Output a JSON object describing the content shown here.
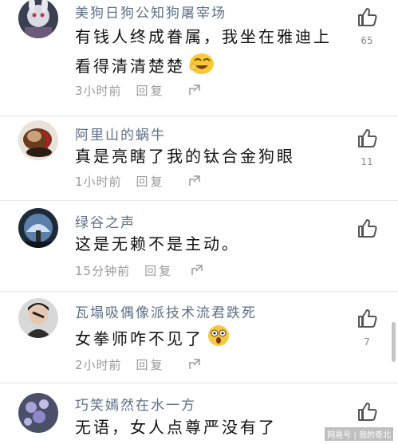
{
  "comments": [
    {
      "username": "美狗日狗公知狗屠宰场",
      "text": "有钱人终成眷属，我坐在雅迪上看得清清楚楚",
      "emoji": "laughing-face-emoji",
      "time": "3小时前",
      "reply": "回复",
      "likes": "65"
    },
    {
      "username": "阿里山的蜗牛",
      "text": "真是亮瞎了我的钛合金狗眼",
      "emoji": "",
      "time": "1小时前",
      "reply": "回复",
      "likes": "11"
    },
    {
      "username": "绿谷之声",
      "text": "这是无赖不是主动。",
      "emoji": "",
      "time": "15分钟前",
      "reply": "回复",
      "likes": ""
    },
    {
      "username": "瓦塌吸偶像派技术流君跌死",
      "text": "女拳师咋不见了",
      "emoji": "shocked-face-emoji",
      "time": "2小时前",
      "reply": "回复",
      "likes": "7"
    },
    {
      "username": "巧笑嫣然在水一方",
      "text": "无语，女人点尊严没有了",
      "emoji": "",
      "time": "",
      "reply": "",
      "likes": ""
    }
  ],
  "watermark": "网易号 | 我的奇北",
  "colors": {
    "username": "#5c6f86",
    "meta": "#9a9a9a",
    "divider": "#e6e6e6",
    "like_icon": "#555555"
  }
}
